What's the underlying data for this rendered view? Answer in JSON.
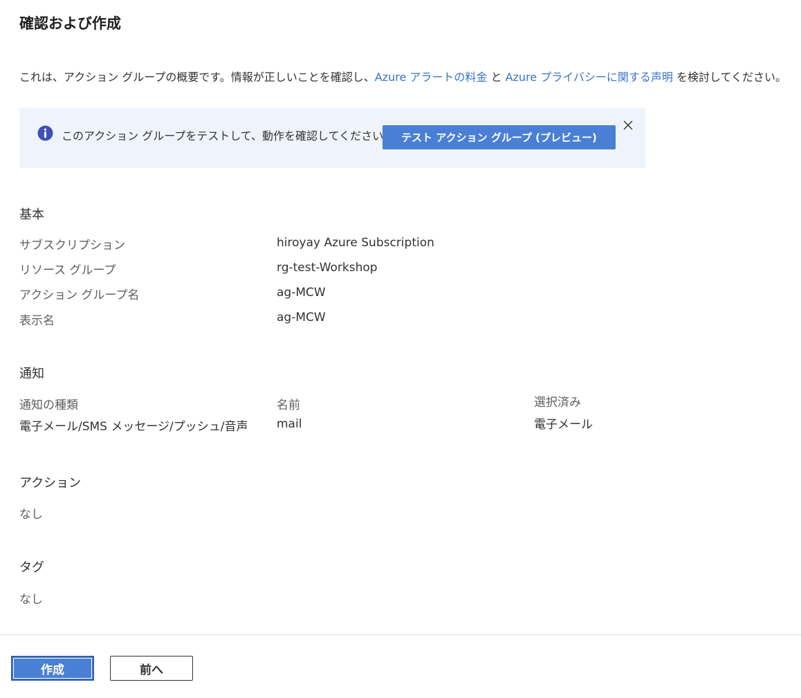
{
  "page": {
    "title": "確認および作成"
  },
  "intro": {
    "text_before": "これは、アクション グループの概要です。情報が正しいことを確認し、",
    "pricing_link": "Azure アラートの料金",
    "text_and": " と ",
    "privacy_link": "Azure プライバシーに関する声明",
    "text_after": " を検討してください。"
  },
  "banner": {
    "icon": "info-icon",
    "message": "このアクション グループをテストして、動作を確認してください。",
    "test_button_label": "テスト アクション グループ (プレビュー)",
    "close_icon": "close-icon"
  },
  "basics": {
    "heading": "基本",
    "rows": [
      {
        "label": "サブスクリプション",
        "value": "hiroyay Azure Subscription"
      },
      {
        "label": "リソース グループ",
        "value": "rg-test-Workshop"
      },
      {
        "label": "アクション グループ名",
        "value": "ag-MCW"
      },
      {
        "label": "表示名",
        "value": "ag-MCW"
      }
    ]
  },
  "notifications": {
    "heading": "通知",
    "columns": [
      "通知の種類",
      "名前",
      "選択済み"
    ],
    "rows": [
      {
        "type": "電子メール/SMS メッセージ/プッシュ/音声",
        "name": "mail",
        "selected": "電子メール"
      }
    ]
  },
  "actions": {
    "heading": "アクション",
    "value": "なし"
  },
  "tags": {
    "heading": "タグ",
    "value": "なし"
  },
  "footer": {
    "create_label": "作成",
    "previous_label": "前へ"
  },
  "colors": {
    "accent": "#4a7fd6",
    "link": "#3a73c7",
    "banner_background": "#eff4fc",
    "info_icon": "#3f51b5"
  }
}
